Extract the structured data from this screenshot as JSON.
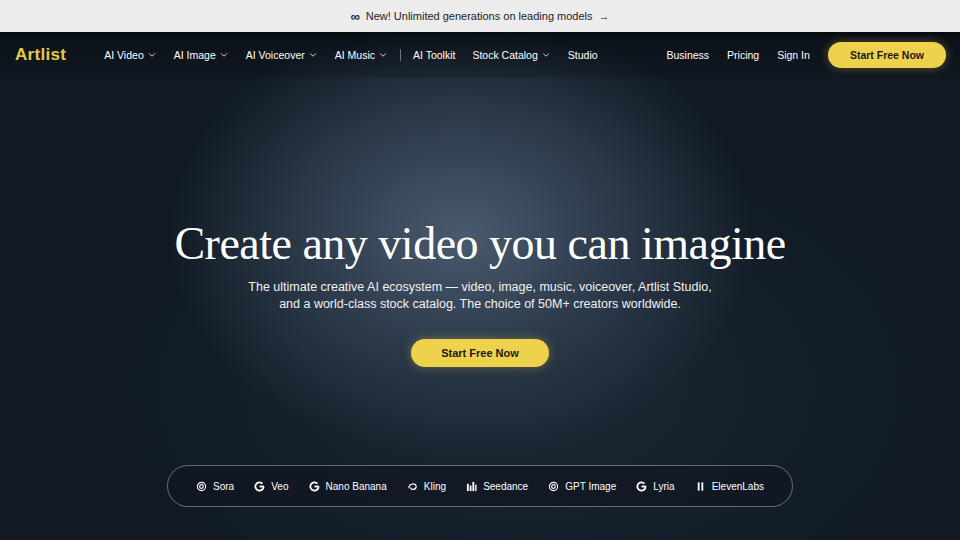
{
  "banner": {
    "icon": "∞",
    "text": "New! Unlimited generations on leading models",
    "arrow": "→"
  },
  "nav": {
    "logo": "Artlist",
    "groups": [
      {
        "items": [
          {
            "label": "AI Video",
            "dropdown": true
          },
          {
            "label": "AI Image",
            "dropdown": true
          },
          {
            "label": "AI Voiceover",
            "dropdown": true
          },
          {
            "label": "AI Music",
            "dropdown": true
          }
        ]
      },
      {
        "items": [
          {
            "label": "AI Toolkit",
            "dropdown": false
          },
          {
            "label": "Stock Catalog",
            "dropdown": true
          },
          {
            "label": "Studio",
            "dropdown": false
          }
        ]
      }
    ],
    "links": [
      "Business",
      "Pricing",
      "Sign In"
    ],
    "cta": "Start Free Now"
  },
  "hero": {
    "title": "Create any video you can imagine",
    "subtitle": [
      "The ultimate creative AI ecosystem — video, image, music, voiceover, Artlist Studio,",
      "and a world-class stock catalog. The choice of 50M+ creators worldwide."
    ],
    "cta": "Start Free Now"
  },
  "models": [
    {
      "label": "Sora",
      "kind": "openai"
    },
    {
      "label": "Veo",
      "kind": "google"
    },
    {
      "label": "Nano Banana",
      "kind": "google"
    },
    {
      "label": "Kling",
      "kind": "kling"
    },
    {
      "label": "Seedance",
      "kind": "bytedance"
    },
    {
      "label": "GPT Image",
      "kind": "openai"
    },
    {
      "label": "Lyria",
      "kind": "google"
    },
    {
      "label": "ElevenLabs",
      "kind": "elevenlabs"
    }
  ]
}
